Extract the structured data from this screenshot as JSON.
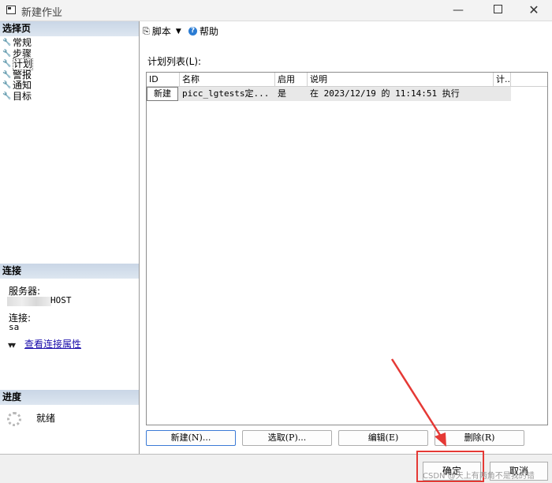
{
  "window": {
    "title": "新建作业"
  },
  "left_panel": {
    "select_page": {
      "header": "选择页",
      "items": [
        {
          "label": "常规"
        },
        {
          "label": "步骤"
        },
        {
          "label": "计划"
        },
        {
          "label": "警报"
        },
        {
          "label": "通知"
        },
        {
          "label": "目标"
        }
      ]
    },
    "connection": {
      "header": "连接",
      "server_label": "服务器:",
      "server_value": "HOST",
      "connection_label": "连接:",
      "connection_value": "sa",
      "view_link": "查看连接属性"
    },
    "progress": {
      "header": "进度",
      "status": "就绪"
    }
  },
  "toolbar": {
    "script_label": "脚本",
    "help_label": "帮助"
  },
  "schedule": {
    "list_label": "计划列表(L):",
    "columns": [
      "ID",
      "名称",
      "启用",
      "说明",
      "计.."
    ],
    "rows": [
      {
        "id": "新建",
        "name": "picc_lgtests定...",
        "enabled": "是",
        "description": "在 2023/12/19 的 11:14:51 执行"
      }
    ],
    "buttons": {
      "new": "新建(N)...",
      "pick": "选取(P)...",
      "edit": "编辑(E)",
      "delete": "删除(R)"
    }
  },
  "dialog_buttons": {
    "ok": "确定",
    "cancel": "取消"
  },
  "watermark": "CSDN @天上有两角不是我的错",
  "colors": {
    "highlight": "#e53935",
    "link": "#1a0dab",
    "section_header": "#c9d6e6"
  }
}
